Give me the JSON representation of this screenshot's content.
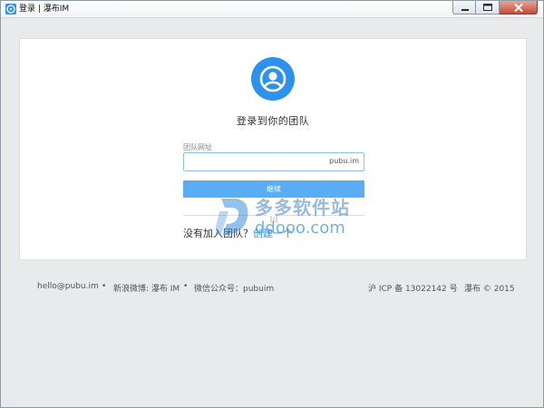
{
  "window": {
    "title": "登录 | 瀑布IM",
    "accent_color": "#2d92ee",
    "controls": [
      {
        "name": "minimize",
        "icon": "minimize-icon"
      },
      {
        "name": "maximize",
        "icon": "maximize-icon"
      },
      {
        "name": "close",
        "icon": "close-icon"
      }
    ]
  },
  "login": {
    "avatar_icon": "user-avatar-icon",
    "title": "登录到你的团队",
    "field_label": "团队网址",
    "field_value": "",
    "field_suffix": "pubu.im",
    "submit_label": "继续",
    "join_prompt": "没有加入团队？",
    "join_link": "创建一个"
  },
  "footer": {
    "email": "hello@pubu.im",
    "separator": "•",
    "weibo": "新浪微博: 瀑布 IM",
    "wechat": "微信公众号：pubuim",
    "icp": "沪 ICP 备 13022142 号",
    "copyright": "瀑布 © 2015"
  },
  "watermark": {
    "text_cn": "多多软件站",
    "text_en": "ddooo.com"
  }
}
